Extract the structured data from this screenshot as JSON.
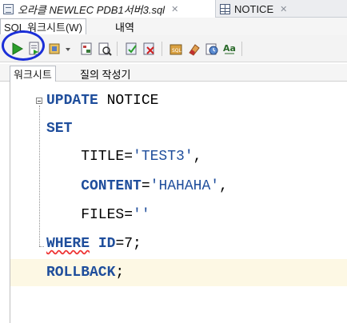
{
  "tabs": [
    {
      "label": "오라클 NEWLEC PDB1서버3.sql",
      "active": true
    },
    {
      "label": "NOTICE",
      "active": false
    }
  ],
  "subtabs": [
    {
      "label": "SQL 워크시트(W)",
      "active": true
    },
    {
      "label": "내역",
      "active": false
    }
  ],
  "toolbar": {
    "buttons": [
      {
        "name": "run-statement-icon",
        "label": "Run Statement"
      },
      {
        "name": "run-script-icon",
        "label": "Run Script"
      },
      {
        "name": "autotrace-icon",
        "label": "Autotrace"
      },
      {
        "name": "dropdown-arrow-icon",
        "label": ""
      },
      {
        "name": "explain-plan-icon",
        "label": "Explain Plan"
      },
      {
        "name": "sql-tuning-icon",
        "label": "SQL Tuning"
      },
      {
        "name": "commit-icon",
        "label": "Commit"
      },
      {
        "name": "rollback-icon",
        "label": "Rollback"
      },
      {
        "name": "unshared-sql-icon",
        "label": "Unshared SQL"
      },
      {
        "name": "clear-icon",
        "label": "Clear"
      },
      {
        "name": "sql-history-icon",
        "label": "SQL History"
      },
      {
        "name": "to-upper-lower-icon",
        "label": "Aa"
      }
    ]
  },
  "worksheet_tabs": [
    {
      "label": "워크시트",
      "active": true
    },
    {
      "label": "질의 작성기",
      "active": false
    }
  ],
  "code": {
    "line1_kw": "UPDATE",
    "line1_rest": " NOTICE",
    "line2_kw": "SET",
    "line3_col": "    TITLE=",
    "line3_str": "'TEST3'",
    "line3_end": ",",
    "line4_col": "    CONTENT",
    "line4_eq": "=",
    "line4_str": "'HAHAHA'",
    "line4_end": ",",
    "line5_col": "    FILES=",
    "line5_str": "''",
    "line6_kw": "WHERE",
    "line6_col": "ID",
    "line6_rest": "=7;",
    "line7_kw": "ROLLBACK",
    "line7_end": ";"
  },
  "colors": {
    "keyword": "#1f4e9c",
    "string": "#1f4e9c",
    "current_line": "#fdf8e4",
    "highlight_circle": "#1b2fd8"
  }
}
